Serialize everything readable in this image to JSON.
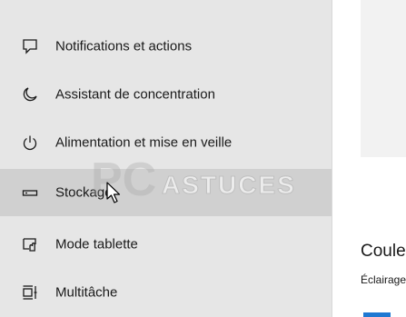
{
  "sidebar": {
    "items": [
      {
        "label": "Notifications et actions",
        "icon": "notification-icon"
      },
      {
        "label": "Assistant de concentration",
        "icon": "moon-icon"
      },
      {
        "label": "Alimentation et mise en veille",
        "icon": "power-icon"
      },
      {
        "label": "Stockage",
        "icon": "storage-icon"
      },
      {
        "label": "Mode tablette",
        "icon": "tablet-mode-icon"
      },
      {
        "label": "Multitâche",
        "icon": "multitasking-icon"
      }
    ]
  },
  "content": {
    "section_title": "Couleur",
    "section_sub": "Éclairage"
  },
  "watermark": {
    "text_a": "PC",
    "text_b": "ASTUCES"
  },
  "colors": {
    "accent": "#1e78d2",
    "sidebar_bg": "#e6e6e6",
    "hover_bg": "#d0d0d0"
  }
}
